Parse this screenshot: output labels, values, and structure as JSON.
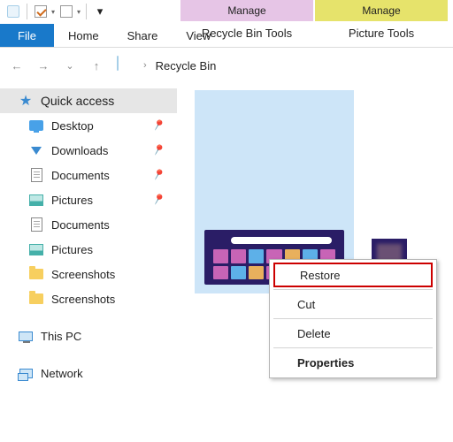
{
  "qat": {
    "dropdown_glyph": "▾"
  },
  "ribbon": {
    "file": "File",
    "tabs": [
      "Home",
      "Share",
      "View"
    ],
    "contextual": [
      {
        "head": "Manage",
        "tab": "Recycle Bin Tools"
      },
      {
        "head": "Manage",
        "tab": "Picture Tools"
      }
    ]
  },
  "nav": {
    "back_glyph": "←",
    "fwd_glyph": "→",
    "up_glyph": "↑",
    "history_glyph": "⌄",
    "crumb_sep": "›",
    "location": "Recycle Bin"
  },
  "sidebar": {
    "quick_access": "Quick access",
    "items": [
      {
        "label": "Desktop",
        "pinned": true
      },
      {
        "label": "Downloads",
        "pinned": true
      },
      {
        "label": "Documents",
        "pinned": true
      },
      {
        "label": "Pictures",
        "pinned": true
      },
      {
        "label": "Documents",
        "pinned": false
      },
      {
        "label": "Pictures",
        "pinned": false
      },
      {
        "label": "Screenshots",
        "pinned": false
      },
      {
        "label": "Screenshots",
        "pinned": false
      }
    ],
    "this_pc": "This PC",
    "network": "Network",
    "pin_glyph": "📌"
  },
  "context_menu": {
    "restore": "Restore",
    "cut": "Cut",
    "delete": "Delete",
    "properties": "Properties"
  }
}
